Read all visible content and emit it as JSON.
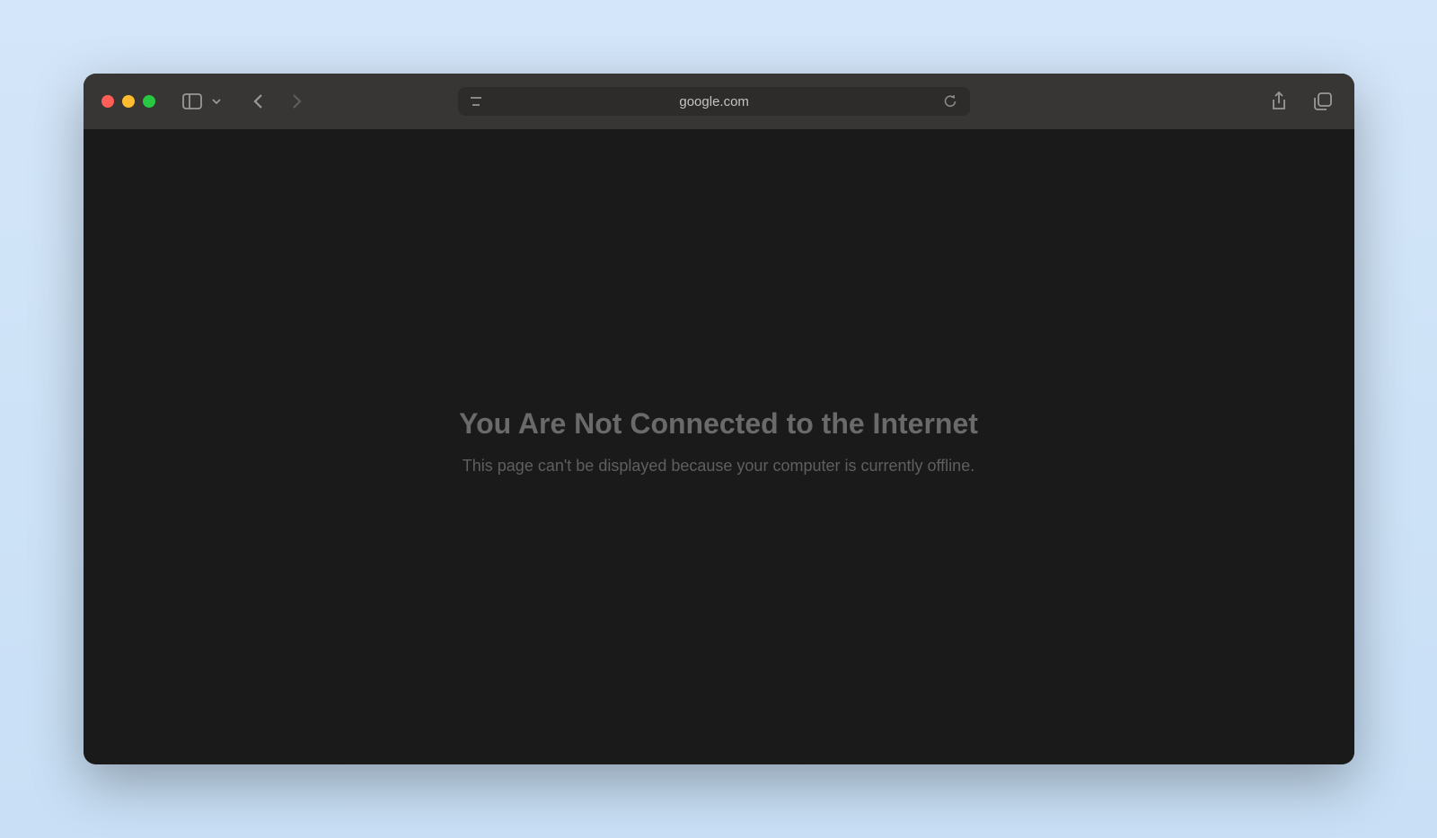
{
  "toolbar": {
    "url": "google.com"
  },
  "error": {
    "heading": "You Are Not Connected to the Internet",
    "message": "This page can't be displayed because your computer is currently offline."
  }
}
